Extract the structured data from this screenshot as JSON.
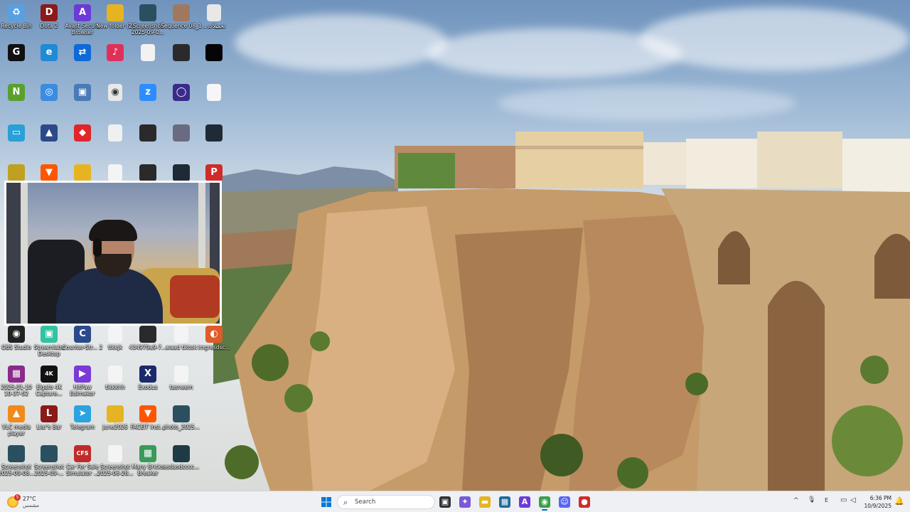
{
  "desktop": {
    "icons": [
      {
        "label": "Recycle Bin",
        "icon": "recycle-bin-icon",
        "color": "#5aa0e0",
        "glyph": "♻"
      },
      {
        "label": "Dota 2",
        "icon": "dota2-icon",
        "color": "#8b1a1a",
        "glyph": "D"
      },
      {
        "label": "Avast Secure Browser",
        "icon": "avast-browser-icon",
        "color": "#6c3ad6",
        "glyph": "A"
      },
      {
        "label": "New folder (2)",
        "icon": "folder-icon",
        "color": "#e6b422",
        "glyph": ""
      },
      {
        "label": "Screenshot 2025-09-0...",
        "icon": "image-file-icon",
        "color": "#2a5060",
        "glyph": ""
      },
      {
        "label": "Sequence 08_1",
        "icon": "video-file-icon",
        "color": "#a07860",
        "glyph": ""
      },
      {
        "label": "...تحميلات",
        "icon": "document-icon",
        "color": "#e8e8e8",
        "glyph": ""
      },
      {
        "label": "",
        "icon": "gamesir-icon",
        "color": "#111111",
        "glyph": "G"
      },
      {
        "label": "",
        "icon": "edge-icon",
        "color": "#1f8ad6",
        "glyph": "e"
      },
      {
        "label": "",
        "icon": "teamviewer-icon",
        "color": "#0e6ad6",
        "glyph": "⇄"
      },
      {
        "label": "",
        "icon": "tiktok-icon",
        "color": "#e0305a",
        "glyph": "♪"
      },
      {
        "label": "",
        "icon": "blank-file-icon",
        "color": "#f2f2f2",
        "glyph": ""
      },
      {
        "label": "",
        "icon": "video-thumb-icon",
        "color": "#2a2a2a",
        "glyph": ""
      },
      {
        "label": "",
        "icon": "black-file-icon",
        "color": "#050505",
        "glyph": ""
      },
      {
        "label": "",
        "icon": "nvidia-icon",
        "color": "#59a12c",
        "glyph": "N"
      },
      {
        "label": "",
        "icon": "network-icon",
        "color": "#3a8ce0",
        "glyph": "◎"
      },
      {
        "label": "",
        "icon": "installer-icon",
        "color": "#4a7ab8",
        "glyph": "▣"
      },
      {
        "label": "",
        "icon": "chrome-icon",
        "color": "#e8e8e8",
        "glyph": "◉"
      },
      {
        "label": "",
        "icon": "zoom-icon",
        "color": "#2d8cff",
        "glyph": "z"
      },
      {
        "label": "",
        "icon": "obs-ring-icon",
        "color": "#3a2a8a",
        "glyph": "◯"
      },
      {
        "label": "",
        "icon": "white-file-icon",
        "color": "#f6f6f6",
        "glyph": ""
      },
      {
        "label": "",
        "icon": "monitor-icon",
        "color": "#2aa0d6",
        "glyph": "▭"
      },
      {
        "label": "",
        "icon": "game-icon",
        "color": "#2c4a8a",
        "glyph": "▲"
      },
      {
        "label": "",
        "icon": "anydesk-icon",
        "color": "#e0262a",
        "glyph": "◆"
      },
      {
        "label": "",
        "icon": "doc-file-icon",
        "color": "#f0f0f0",
        "glyph": ""
      },
      {
        "label": "",
        "icon": "phone-file-icon",
        "color": "#2a2a2a",
        "glyph": ""
      },
      {
        "label": "",
        "icon": "screenshot-icon",
        "color": "#6a6a80",
        "glyph": ""
      },
      {
        "label": "",
        "icon": "dark-file-icon",
        "color": "#1e2a35",
        "glyph": ""
      },
      {
        "label": "",
        "icon": "archive-icon",
        "color": "#c0a020",
        "glyph": ""
      },
      {
        "label": "",
        "icon": "faceit-icon",
        "color": "#ff5500",
        "glyph": "▼"
      },
      {
        "label": "",
        "icon": "folder2-icon",
        "color": "#e6b422",
        "glyph": ""
      },
      {
        "label": "",
        "icon": "paper-icon",
        "color": "#f4f4f4",
        "glyph": ""
      },
      {
        "label": "",
        "icon": "phone2-file-icon",
        "color": "#2a2a2a",
        "glyph": ""
      },
      {
        "label": "",
        "icon": "dark2-file-icon",
        "color": "#1e2a35",
        "glyph": ""
      },
      {
        "label": "",
        "icon": "pdf-icon",
        "color": "#d02a2a",
        "glyph": "P"
      },
      {
        "label": "OBS Studio",
        "icon": "obs-icon",
        "color": "#222222",
        "glyph": "◉"
      },
      {
        "label": "Streamlabs Desktop",
        "icon": "streamlabs-icon",
        "color": "#31c3a2",
        "glyph": "▣"
      },
      {
        "label": "Counter-Str... 2",
        "icon": "cs2-icon",
        "color": "#2a4a8a",
        "glyph": "C"
      },
      {
        "label": "tikkjk",
        "icon": "file-icon",
        "color": "#f4f4f4",
        "glyph": ""
      },
      {
        "label": "434979a9-7...",
        "icon": "phone-video-icon",
        "color": "#2a2a2a",
        "glyph": ""
      },
      {
        "label": "waad tiktok",
        "icon": "white-video-icon",
        "color": "#f4f4f4",
        "glyph": ""
      },
      {
        "label": "imgresdsc...",
        "icon": "image-red-icon",
        "color": "#e05a2a",
        "glyph": "◐"
      },
      {
        "label": "2025-01-10 10-37-52",
        "icon": "winrar-icon",
        "color": "#8a2a8a",
        "glyph": "▦"
      },
      {
        "label": "Elgato 4K Capture...",
        "icon": "elgato-icon",
        "color": "#111111",
        "glyph": "4K"
      },
      {
        "label": "HitPaw Edimakor",
        "icon": "hitpaw-icon",
        "color": "#7a3ad6",
        "glyph": "▶"
      },
      {
        "label": "tikkkhh",
        "icon": "file2-icon",
        "color": "#f4f4f4",
        "glyph": ""
      },
      {
        "label": "Exodus",
        "icon": "exodus-icon",
        "color": "#1a2a6a",
        "glyph": "X"
      },
      {
        "label": "tasneem",
        "icon": "white-file2-icon",
        "color": "#f4f4f4",
        "glyph": ""
      },
      {
        "label": "",
        "icon": "none-icon",
        "color": "transparent",
        "glyph": ""
      },
      {
        "label": "VLC media player",
        "icon": "vlc-icon",
        "color": "#f08a1c",
        "glyph": "▲"
      },
      {
        "label": "Liar's Bar",
        "icon": "liars-bar-icon",
        "color": "#8a1a1a",
        "glyph": "L"
      },
      {
        "label": "Telegram",
        "icon": "telegram-icon",
        "color": "#2aa3e0",
        "glyph": "➤"
      },
      {
        "label": "june2026",
        "icon": "folder3-icon",
        "color": "#e6b422",
        "glyph": ""
      },
      {
        "label": "FACEIT Inst...",
        "icon": "faceit2-icon",
        "color": "#ff5500",
        "glyph": "▼"
      },
      {
        "label": "photo_2025...",
        "icon": "photo-icon",
        "color": "#2a5060",
        "glyph": ""
      },
      {
        "label": "",
        "icon": "none2-icon",
        "color": "transparent",
        "glyph": ""
      },
      {
        "label": "Screenshot 2025-09-08...",
        "icon": "screenshot2-icon",
        "color": "#2a5060",
        "glyph": ""
      },
      {
        "label": "Screenshot 2025-09-...",
        "icon": "screenshot3-icon",
        "color": "#2a5060",
        "glyph": ""
      },
      {
        "label": "Car For Sale Simulator ...",
        "icon": "car-sale-icon",
        "color": "#c02a2a",
        "glyph": "CFS"
      },
      {
        "label": "Screenshot 2025-06-28...",
        "icon": "screenshot4-icon",
        "color": "#f4f4f4",
        "glyph": ""
      },
      {
        "label": "Many Bricks Breaker",
        "icon": "bricks-icon",
        "color": "#3a9a5a",
        "glyph": "▦"
      },
      {
        "label": "asdasdcccc...",
        "icon": "dark3-file-icon",
        "color": "#1e3a45",
        "glyph": ""
      },
      {
        "label": "",
        "icon": "none3-icon",
        "color": "transparent",
        "glyph": ""
      }
    ]
  },
  "taskbar": {
    "weather": {
      "temp": "27°C",
      "condition": "مشمس",
      "badge": "5"
    },
    "start_icon": "windows-start-icon",
    "search_placeholder": "Search",
    "apps": [
      {
        "name": "task-view-icon",
        "color": "#333333",
        "glyph": "▣",
        "active": false
      },
      {
        "name": "copilot-icon",
        "color": "#7a5ad6",
        "glyph": "✦",
        "active": false
      },
      {
        "name": "file-explorer-icon",
        "color": "#e6b422",
        "glyph": "▬",
        "active": false
      },
      {
        "name": "microsoft-store-icon",
        "color": "#1f6a9a",
        "glyph": "▦",
        "active": false
      },
      {
        "name": "avast-taskbar-icon",
        "color": "#6c3ad6",
        "glyph": "A",
        "active": false
      },
      {
        "name": "chrome-taskbar-icon",
        "color": "#3aa04a",
        "glyph": "◉",
        "active": true
      },
      {
        "name": "discord-taskbar-icon",
        "color": "#5865f2",
        "glyph": "☺",
        "active": false
      },
      {
        "name": "app-red-taskbar-icon",
        "color": "#d02a2a",
        "glyph": "●",
        "active": false
      }
    ],
    "tray": {
      "chevron": "^",
      "mic": "🎙",
      "lang": "E",
      "time": "6:36 PM",
      "date": "10/9/2025"
    }
  }
}
